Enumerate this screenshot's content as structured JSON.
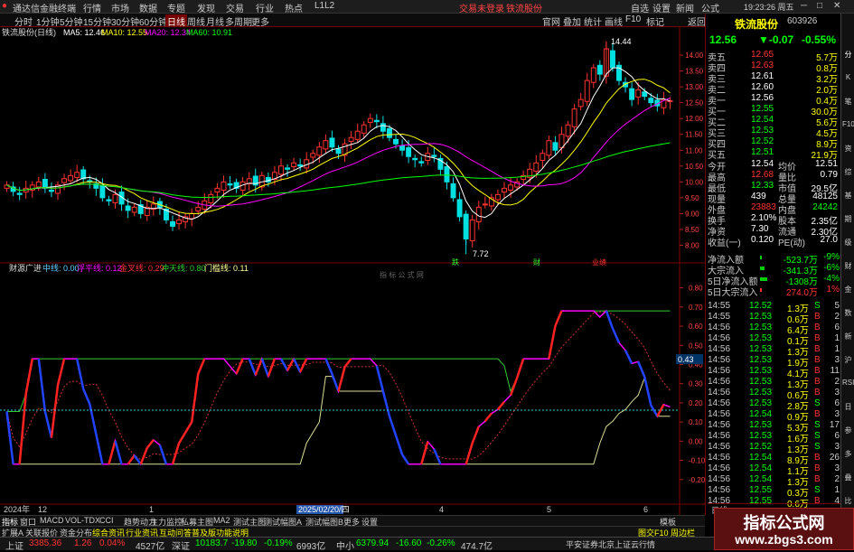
{
  "window": {
    "title": "通达信金融终端",
    "menus": [
      "行情",
      "市场",
      "数据",
      "专题",
      "发现",
      "交易",
      "行业",
      "热点",
      "L1L2"
    ],
    "trade_notice": "交易未登录",
    "stock": "铁流股份",
    "right_menus": [
      "自选",
      "设置",
      "新闻",
      "公式"
    ],
    "clock": "19:23:26 周五"
  },
  "toolbar": {
    "periods": [
      "分时",
      "1分钟",
      "5分钟",
      "15分钟",
      "30分钟",
      "60分钟",
      "日线",
      "周线",
      "月线",
      "多周期",
      "更多"
    ],
    "right_tools": [
      "官网",
      "叠加",
      "统计",
      "画线",
      "F10",
      "标记",
      "返回"
    ]
  },
  "indicators": {
    "ma_title": "铁流股份(日线)",
    "ma5": "MA5: 12.46",
    "ma10": "MA10: 12.55",
    "ma20": "MA20: 12.34",
    "ma60": "MA60: 10.91",
    "osc_name": "财源广进",
    "osc_zx": "中线: 0.00",
    "osc_fqx": "浮平线: 0.12",
    "osc_yxx": "金叉线: 0.29",
    "osc_mx": "冲天线: 0.80",
    "osc_mlx": "门槛线: 0.11",
    "watermark_center": "指 标 公 式 网",
    "value_label": "0.43",
    "high_label": "14.44",
    "low_label": "7.72"
  },
  "colors": {
    "up": "#ff3232",
    "down": "#00e0e0",
    "ma5": "#ffffff",
    "ma10": "#ffff00",
    "ma20": "#ff00ff",
    "ma60": "#00ff00"
  },
  "chart_data": [
    {
      "type": "candlestick",
      "title": "铁流股份(日线)",
      "y_ticks": [
        "14.00",
        "13.50",
        "13.00",
        "12.50",
        "12.00",
        "11.50",
        "11.00",
        "10.50",
        "10.00",
        "9.50",
        "9.00",
        "8.50",
        "8.00"
      ],
      "ylim": [
        7.7,
        14.6
      ],
      "high": 14.44,
      "low": 7.72,
      "close": [
        9.9,
        9.7,
        9.6,
        9.8,
        9.9,
        10.0,
        9.8,
        9.7,
        9.9,
        10.1,
        10.2,
        10.3,
        10.1,
        10.0,
        9.8,
        9.5,
        9.4,
        9.6,
        9.3,
        9.1,
        9.2,
        9.0,
        9.2,
        9.3,
        9.2,
        8.8,
        8.6,
        8.8,
        8.9,
        9.0,
        9.2,
        9.4,
        9.6,
        9.8,
        10.0,
        9.9,
        9.8,
        10.0,
        10.1,
        9.9,
        10.2,
        10.0,
        10.3,
        10.5,
        10.4,
        10.6,
        10.5,
        10.7,
        10.9,
        11.1,
        11.3,
        11.1,
        10.9,
        11.2,
        11.4,
        11.6,
        11.8,
        12.0,
        11.9,
        11.6,
        11.4,
        11.2,
        11.0,
        10.8,
        10.7,
        10.6,
        10.9,
        10.8,
        10.4,
        10.0,
        9.5,
        8.9,
        8.2,
        8.8,
        9.2,
        9.3,
        9.5,
        9.6,
        9.8,
        9.9,
        10.0,
        10.2,
        10.4,
        10.6,
        10.9,
        11.3,
        11.0,
        11.5,
        11.8,
        12.3,
        12.6,
        13.2,
        13.6,
        13.4,
        14.2,
        13.6,
        13.2,
        13.0,
        12.6,
        12.9,
        12.7,
        12.5,
        12.4,
        12.6,
        12.56
      ],
      "ma": [
        {
          "name": "MA5",
          "value": 12.46
        },
        {
          "name": "MA10",
          "value": 12.55
        },
        {
          "name": "MA20",
          "value": 12.34
        },
        {
          "name": "MA60",
          "value": 10.91
        }
      ],
      "markers": [
        "跌",
        "财",
        "业绩"
      ]
    },
    {
      "type": "line",
      "title": "财源广进",
      "y_ticks": [
        "0.80",
        "0.70",
        "0.60",
        "0.50",
        "0.40",
        "0.30",
        "0.20",
        "0.10",
        "0.00",
        "-0.10",
        "-0.20"
      ],
      "ylim": [
        -0.3,
        0.85
      ],
      "x_labels": [
        "2024年",
        "12",
        "1",
        "2025/02/20/四",
        "3",
        "4",
        "5",
        "6"
      ],
      "series": [
        {
          "name": "中线",
          "value": 0.0
        },
        {
          "name": "浮平线",
          "value": 0.12
        },
        {
          "name": "金叉线",
          "value": 0.29
        },
        {
          "name": "冲天线",
          "value": 0.8
        },
        {
          "name": "门槛线",
          "value": 0.11
        }
      ]
    }
  ],
  "quote": {
    "name": "铁流股份",
    "code": "603926",
    "price": "12.56",
    "change": "▼-0.07",
    "pct": "-0.55%",
    "asks": [
      [
        "卖五",
        "12.65",
        "5.7万"
      ],
      [
        "卖四",
        "12.63",
        "0.8万"
      ],
      [
        "卖三",
        "12.61",
        "3.2万"
      ],
      [
        "卖二",
        "12.60",
        "2.0万"
      ],
      [
        "卖一",
        "12.56",
        "0.4万"
      ]
    ],
    "bids": [
      [
        "买一",
        "12.55",
        "30.0万"
      ],
      [
        "买二",
        "12.54",
        "5.6万"
      ],
      [
        "买三",
        "12.53",
        "4.5万"
      ],
      [
        "买四",
        "12.52",
        "8.9万"
      ],
      [
        "买五",
        "12.51",
        "21.9万"
      ]
    ],
    "stats": [
      [
        "今开",
        "12.54",
        "均价",
        "12.51"
      ],
      [
        "最高",
        "12.68",
        "量比",
        "0.79"
      ],
      [
        "最低",
        "12.33",
        "市值",
        "29.5亿"
      ],
      [
        "现量",
        "439",
        "总量",
        "48125"
      ],
      [
        "外盘",
        "23883",
        "内盘",
        "24242"
      ],
      [
        "换手",
        "2.10%",
        "股本",
        "2.35亿"
      ],
      [
        "净资",
        "7.30",
        "流通",
        "2.30亿"
      ],
      [
        "收益(一)",
        "0.120",
        "PE(动)",
        "27.0"
      ]
    ],
    "flows": [
      [
        "净流入额",
        "-523.7万",
        "-9%"
      ],
      [
        "大宗流入",
        "-341.3万",
        "-6%"
      ],
      [
        "5日净流入额",
        "-1308万",
        "-4%"
      ],
      [
        "5日大宗流入",
        "274.0万",
        "1%"
      ]
    ],
    "ticks": [
      [
        "14:55",
        "12.52",
        "1.3万",
        "S",
        "5"
      ],
      [
        "14:55",
        "12.53",
        "0.6万",
        "B",
        "2"
      ],
      [
        "14:56",
        "12.53",
        "6.4万",
        "B",
        "6"
      ],
      [
        "14:56",
        "12.53",
        "0.1万",
        "B",
        "1"
      ],
      [
        "14:56",
        "12.53",
        "1.3万",
        "B",
        "1"
      ],
      [
        "14:56",
        "12.53",
        "1.9万",
        "B",
        "3"
      ],
      [
        "14:56",
        "12.53",
        "4.1万",
        "B",
        "11"
      ],
      [
        "14:56",
        "12.53",
        "1.3万",
        "B",
        "2"
      ],
      [
        "14:56",
        "12.53",
        "0.6万",
        "B",
        "3"
      ],
      [
        "14:56",
        "12.53",
        "2.8万",
        "S",
        "6"
      ],
      [
        "14:56",
        "12.54",
        "0.9万",
        "B",
        "3"
      ],
      [
        "14:56",
        "12.53",
        "5.3万",
        "S",
        "17"
      ],
      [
        "14:56",
        "12.53",
        "1.6万",
        "S",
        "6"
      ],
      [
        "14:56",
        "12.52",
        "1.3万",
        "S",
        "3"
      ],
      [
        "14:56",
        "12.54",
        "8.9万",
        "B",
        "26"
      ],
      [
        "14:56",
        "12.54",
        "1.1万",
        "B",
        "3"
      ],
      [
        "14:56",
        "12.54",
        "1.3万",
        "B",
        "2"
      ],
      [
        "14:56",
        "12.55",
        "0.3万",
        "S",
        "1"
      ],
      [
        "14:56",
        "12.55",
        "0.6万",
        "B",
        "4"
      ]
    ],
    "period_btn": "日线"
  },
  "bottom_tabs": {
    "row1": [
      "指标",
      "窗口",
      "MACD",
      "VOL-TDX",
      "CCI",
      "趋势动力",
      "主力监控",
      "私募主图",
      "MA2",
      "测试主图",
      "测试幅图A",
      "测试幅图B",
      "更多",
      "设置"
    ],
    "row1_right": "模板",
    "row2": [
      "扩展A",
      "关联报价",
      "资金分布",
      "综合资讯",
      "行业资讯",
      "互动问答",
      "普及版功能说明"
    ],
    "row2_right": "图交F10 周边栏"
  },
  "statusbar": {
    "sh_label": "上证",
    "sh_val": "3385.36",
    "sh_chg": "1.26",
    "sh_pct": "0.04%",
    "sh_amt": "4527亿",
    "sz_label": "深证",
    "sz_val": "10183.7",
    "sz_chg": "-19.80",
    "sz_pct": "-0.19%",
    "sz_amt": "6993亿",
    "zx_label": "中小",
    "zx_val": "6379.94",
    "zx_chg": "-16.60",
    "zx_pct": "-0.26%",
    "zx_amt": "474.7亿",
    "broker": "平安证券北京上证云行情"
  },
  "sidebar": [
    "分",
    "K",
    "笔",
    "F10",
    "资",
    "综",
    "基",
    "期",
    "级",
    "财",
    "金",
    "数",
    "新",
    "沪",
    "RSI",
    "日",
    "参",
    "多",
    "叠",
    "比"
  ],
  "site": {
    "name": "指标公式网",
    "url": "www.zbgs3.com"
  }
}
